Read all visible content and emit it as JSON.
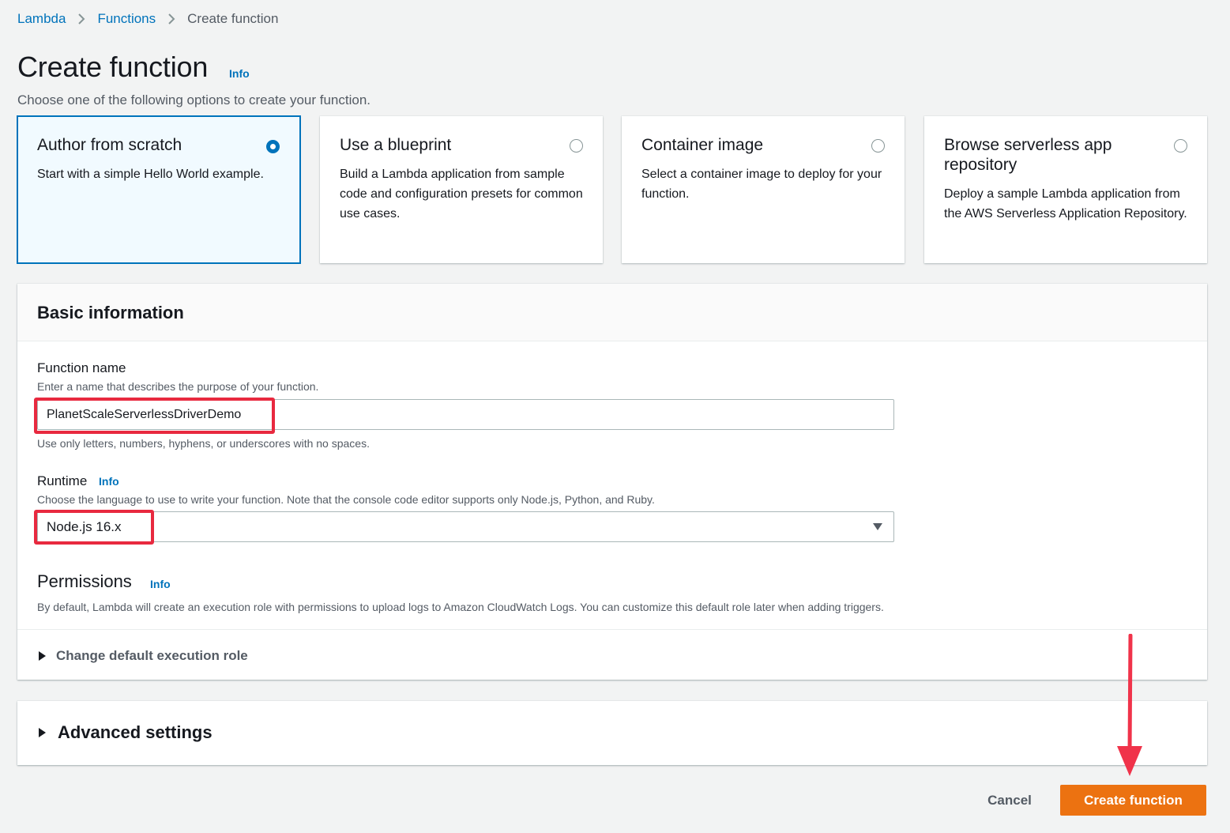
{
  "breadcrumb": {
    "items": [
      {
        "label": "Lambda"
      },
      {
        "label": "Functions"
      },
      {
        "label": "Create function"
      }
    ]
  },
  "header": {
    "title": "Create function",
    "info": "Info",
    "subtitle": "Choose one of the following options to create your function."
  },
  "options": [
    {
      "title": "Author from scratch",
      "description": "Start with a simple Hello World example.",
      "selected": true
    },
    {
      "title": "Use a blueprint",
      "description": "Build a Lambda application from sample code and configuration presets for common use cases.",
      "selected": false
    },
    {
      "title": "Container image",
      "description": "Select a container image to deploy for your function.",
      "selected": false
    },
    {
      "title": "Browse serverless app repository",
      "description": "Deploy a sample Lambda application from the AWS Serverless Application Repository.",
      "selected": false
    }
  ],
  "basic_info": {
    "title": "Basic information",
    "function_name": {
      "label": "Function name",
      "description": "Enter a name that describes the purpose of your function.",
      "value": "PlanetScaleServerlessDriverDemo",
      "constraint": "Use only letters, numbers, hyphens, or underscores with no spaces."
    },
    "runtime": {
      "label": "Runtime",
      "info": "Info",
      "description": "Choose the language to use to write your function. Note that the console code editor supports only Node.js, Python, and Ruby.",
      "value": "Node.js 16.x"
    },
    "permissions": {
      "title": "Permissions",
      "info": "Info",
      "description": "By default, Lambda will create an execution role with permissions to upload logs to Amazon CloudWatch Logs. You can customize this default role later when adding triggers.",
      "expander": "Change default execution role"
    }
  },
  "advanced": {
    "title": "Advanced settings"
  },
  "footer": {
    "cancel": "Cancel",
    "create": "Create function"
  },
  "colors": {
    "accent": "#0073bb",
    "primary_button": "#ec7211",
    "annotation": "#e8293f"
  }
}
